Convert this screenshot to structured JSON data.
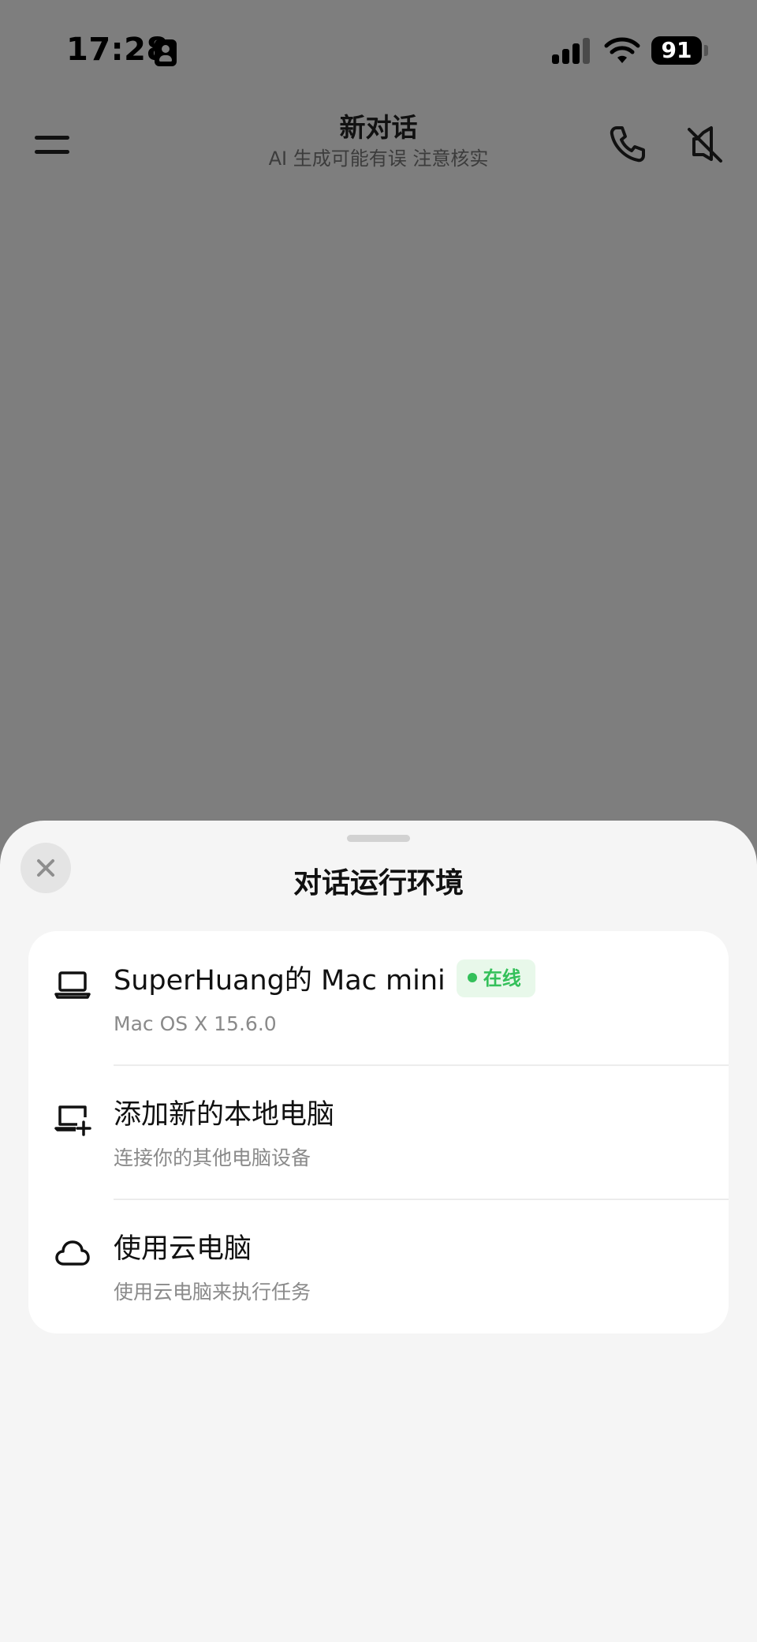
{
  "status_bar": {
    "time": "17:28",
    "battery": "91",
    "icons": [
      "contact-card-icon",
      "cellular-signal-icon",
      "wifi-icon",
      "battery-icon"
    ]
  },
  "header": {
    "title": "新对话",
    "subtitle": "AI 生成可能有误 注意核实",
    "icons": [
      "menu-icon",
      "phone-icon",
      "speaker-muted-icon"
    ]
  },
  "sheet": {
    "title": "对话运行环境",
    "close_icon": "close-icon",
    "options": [
      {
        "icon": "laptop-icon",
        "title": "SuperHuang的 Mac mini",
        "subtitle": "Mac OS X 15.6.0",
        "badge": "在线",
        "badge_color": "#34c05a"
      },
      {
        "icon": "laptop-add-icon",
        "title": "添加新的本地电脑",
        "subtitle": "连接你的其他电脑设备"
      },
      {
        "icon": "cloud-icon",
        "title": "使用云电脑",
        "subtitle": "使用云电脑来执行任务"
      }
    ]
  },
  "colors": {
    "overlay": "#7e7e7e",
    "sheet_background": "#f5f5f5",
    "card_background": "#ffffff",
    "online_green": "#34c05a"
  }
}
